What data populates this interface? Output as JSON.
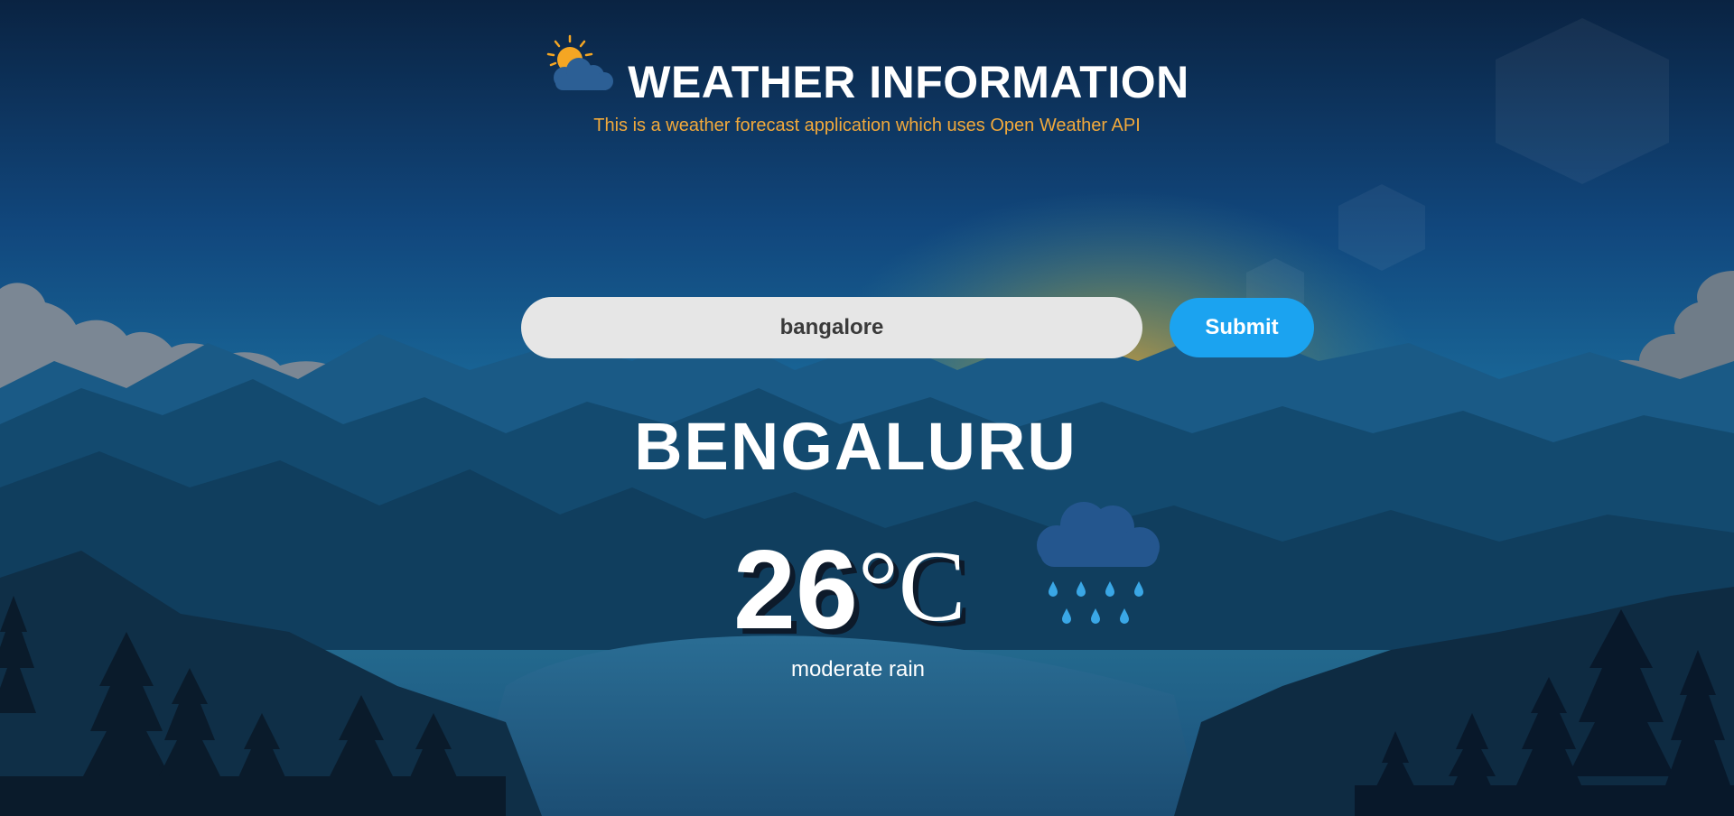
{
  "header": {
    "title": "WEATHER INFORMATION",
    "subtitle": "This is a weather forecast application which uses Open Weather API",
    "logo_icon": "sun-cloud-icon"
  },
  "search": {
    "value": "bangalore",
    "submit_label": "Submit"
  },
  "weather": {
    "city": "BENGALURU",
    "temperature": "26",
    "unit": "°C",
    "description": "moderate rain",
    "condition_icon": "rain-cloud-icon"
  },
  "colors": {
    "accent": "#1ba3f0",
    "subtitle": "#f2a93b",
    "sun": "#f5a623"
  }
}
